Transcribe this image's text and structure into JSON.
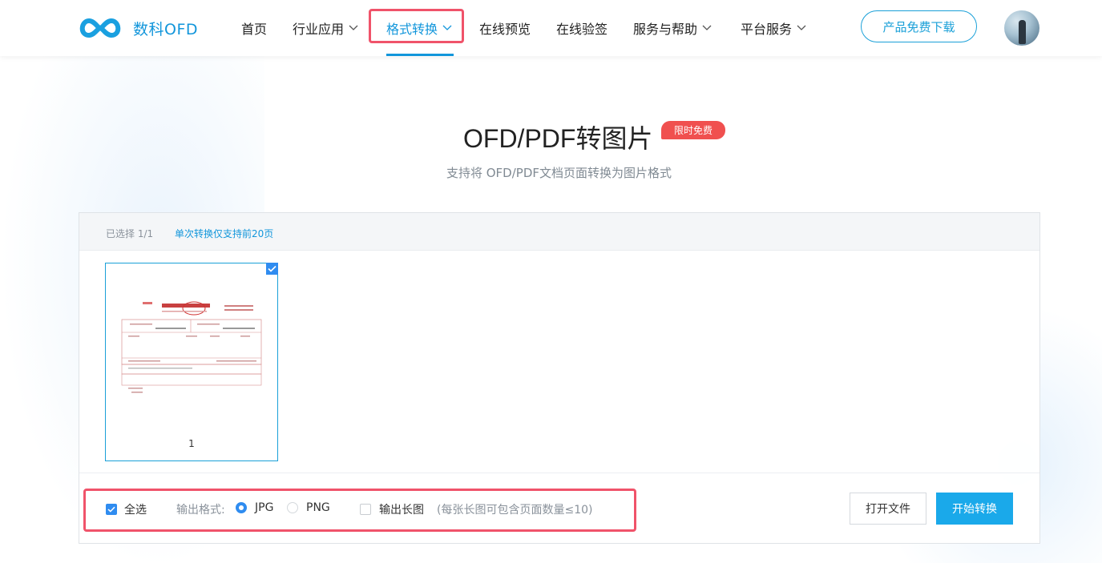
{
  "brand": {
    "name": "数科OFD"
  },
  "nav": {
    "home": "首页",
    "industry": "行业应用",
    "format_convert": "格式转换",
    "online_preview": "在线预览",
    "online_verify": "在线验签",
    "service_help": "服务与帮助",
    "platform": "平台服务"
  },
  "header": {
    "download_label": "产品免费下载"
  },
  "main": {
    "title": "OFD/PDF转图片",
    "badge": "限时免费",
    "subtitle": "支持将 OFD/PDF文档页面转换为图片格式"
  },
  "panel": {
    "selected": "已选择 1/1",
    "limit_note": "单次转换仅支持前20页",
    "pages": [
      {
        "number": "1",
        "checked": true
      }
    ]
  },
  "options": {
    "select_all": "全选",
    "format_label": "输出格式:",
    "format_jpg": "JPG",
    "format_png": "PNG",
    "selected_format": "JPG",
    "long_image": "输出长图",
    "long_image_note": "(每张长图可包含页面数量≤10)"
  },
  "actions": {
    "open_file": "打开文件",
    "start_convert": "开始转换"
  },
  "colors": {
    "brand": "#1296db",
    "accent": "#1aa9ea",
    "badge": "#f0504f",
    "highlight": "#f0536a"
  }
}
